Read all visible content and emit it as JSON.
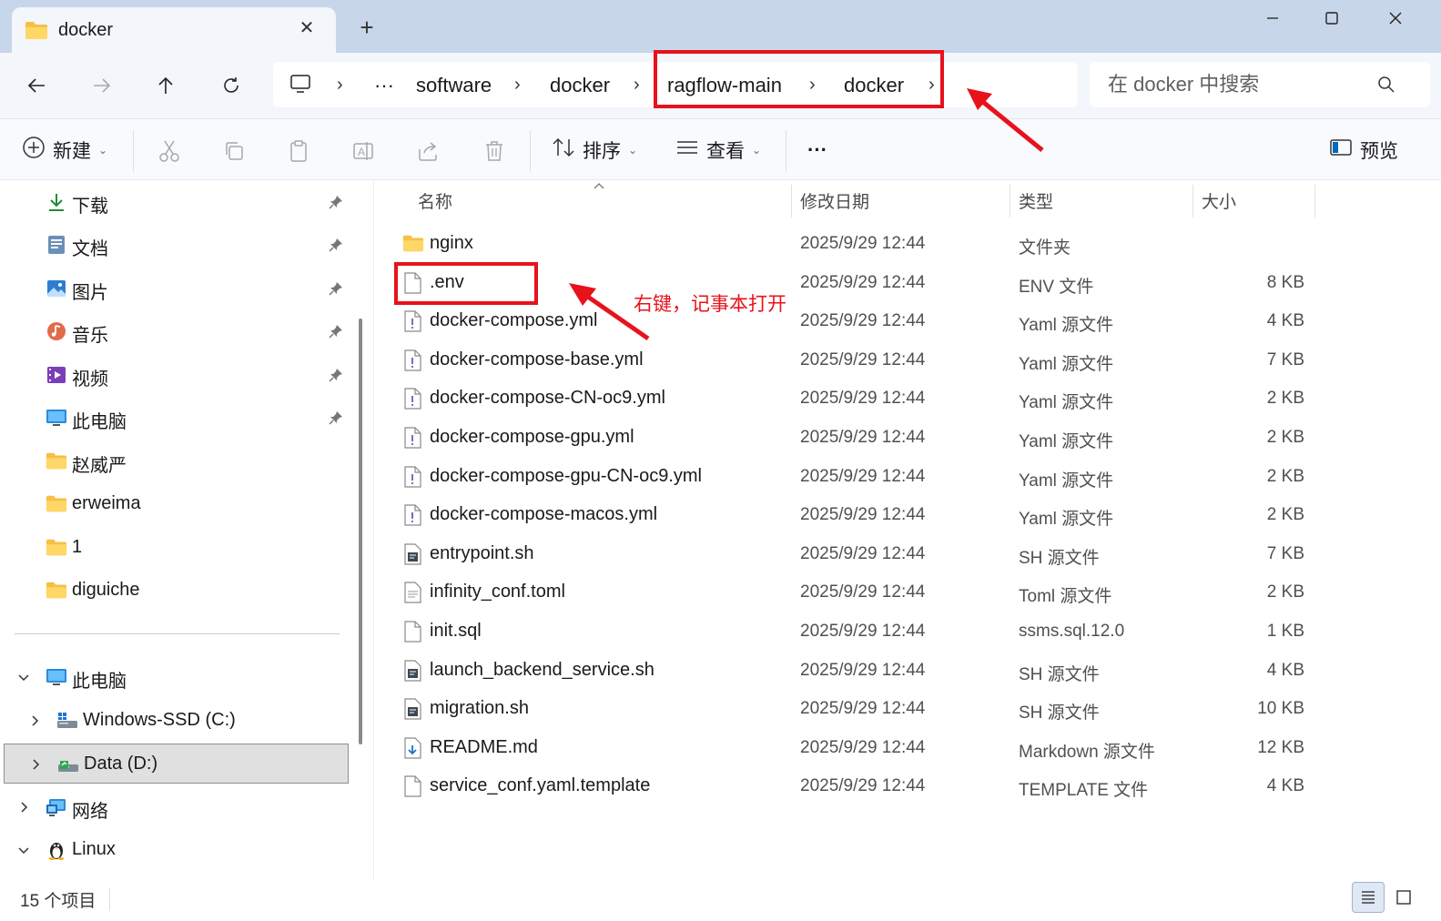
{
  "window": {
    "tab_title": "docker",
    "tab_close": "✕",
    "new_tab": "+"
  },
  "nav": {
    "breadcrumb": [
      "software",
      "docker",
      "ragflow-main",
      "docker"
    ],
    "overflow": "···",
    "search_placeholder": "在 docker 中搜索"
  },
  "commands": {
    "new": "新建",
    "sort": "排序",
    "view": "查看",
    "more": "···",
    "preview": "预览"
  },
  "sidebar": {
    "quick_access": [
      {
        "label": "下载",
        "icon": "download-icon",
        "pinned": true
      },
      {
        "label": "文档",
        "icon": "documents-icon",
        "pinned": true
      },
      {
        "label": "图片",
        "icon": "pictures-icon",
        "pinned": true
      },
      {
        "label": "音乐",
        "icon": "music-icon",
        "pinned": true
      },
      {
        "label": "视频",
        "icon": "videos-icon",
        "pinned": true
      },
      {
        "label": "此电脑",
        "icon": "computer-icon",
        "pinned": true
      },
      {
        "label": "赵威严",
        "icon": "folder-icon",
        "pinned": false
      },
      {
        "label": "erweima",
        "icon": "folder-icon",
        "pinned": false
      },
      {
        "label": "1",
        "icon": "folder-icon",
        "pinned": false
      },
      {
        "label": "diguiche",
        "icon": "folder-icon",
        "pinned": false
      }
    ],
    "tree": [
      {
        "label": "此电脑",
        "icon": "computer-icon",
        "expanded": true
      },
      {
        "label": "Windows-SSD (C:)",
        "icon": "drive-c-icon",
        "expanded": false
      },
      {
        "label": "Data (D:)",
        "icon": "drive-d-icon",
        "expanded": false,
        "selected": true
      },
      {
        "label": "网络",
        "icon": "network-icon",
        "expanded": false
      },
      {
        "label": "Linux",
        "icon": "linux-icon",
        "expanded": true
      }
    ]
  },
  "columns": {
    "name": "名称",
    "date": "修改日期",
    "type": "类型",
    "size": "大小"
  },
  "files": [
    {
      "name": "nginx",
      "date": "2025/9/29 12:44",
      "type": "文件夹",
      "size": "",
      "icon": "folder-icon"
    },
    {
      "name": ".env",
      "date": "2025/9/29 12:44",
      "type": "ENV 文件",
      "size": "8 KB",
      "icon": "blank-file-icon"
    },
    {
      "name": "docker-compose.yml",
      "date": "2025/9/29 12:44",
      "type": "Yaml 源文件",
      "size": "4 KB",
      "icon": "yaml-file-icon"
    },
    {
      "name": "docker-compose-base.yml",
      "date": "2025/9/29 12:44",
      "type": "Yaml 源文件",
      "size": "7 KB",
      "icon": "yaml-file-icon"
    },
    {
      "name": "docker-compose-CN-oc9.yml",
      "date": "2025/9/29 12:44",
      "type": "Yaml 源文件",
      "size": "2 KB",
      "icon": "yaml-file-icon"
    },
    {
      "name": "docker-compose-gpu.yml",
      "date": "2025/9/29 12:44",
      "type": "Yaml 源文件",
      "size": "2 KB",
      "icon": "yaml-file-icon"
    },
    {
      "name": "docker-compose-gpu-CN-oc9.yml",
      "date": "2025/9/29 12:44",
      "type": "Yaml 源文件",
      "size": "2 KB",
      "icon": "yaml-file-icon"
    },
    {
      "name": "docker-compose-macos.yml",
      "date": "2025/9/29 12:44",
      "type": "Yaml 源文件",
      "size": "2 KB",
      "icon": "yaml-file-icon"
    },
    {
      "name": "entrypoint.sh",
      "date": "2025/9/29 12:44",
      "type": "SH 源文件",
      "size": "7 KB",
      "icon": "script-file-icon"
    },
    {
      "name": "infinity_conf.toml",
      "date": "2025/9/29 12:44",
      "type": "Toml 源文件",
      "size": "2 KB",
      "icon": "text-file-icon"
    },
    {
      "name": "init.sql",
      "date": "2025/9/29 12:44",
      "type": "ssms.sql.12.0",
      "size": "1 KB",
      "icon": "blank-file-icon"
    },
    {
      "name": "launch_backend_service.sh",
      "date": "2025/9/29 12:44",
      "type": "SH 源文件",
      "size": "4 KB",
      "icon": "script-file-icon"
    },
    {
      "name": "migration.sh",
      "date": "2025/9/29 12:44",
      "type": "SH 源文件",
      "size": "10 KB",
      "icon": "script-file-icon"
    },
    {
      "name": "README.md",
      "date": "2025/9/29 12:44",
      "type": "Markdown 源文件",
      "size": "12 KB",
      "icon": "markdown-file-icon"
    },
    {
      "name": "service_conf.yaml.template",
      "date": "2025/9/29 12:44",
      "type": "TEMPLATE 文件",
      "size": "4 KB",
      "icon": "blank-file-icon"
    }
  ],
  "annotation": {
    "text": "右键，记事本打开",
    "color": "#e8121b"
  },
  "status": {
    "count": "15 个项目"
  },
  "colors": {
    "titlebar": "#c8d6e9",
    "accent": "#0067c0",
    "folder": "#f7c948"
  }
}
